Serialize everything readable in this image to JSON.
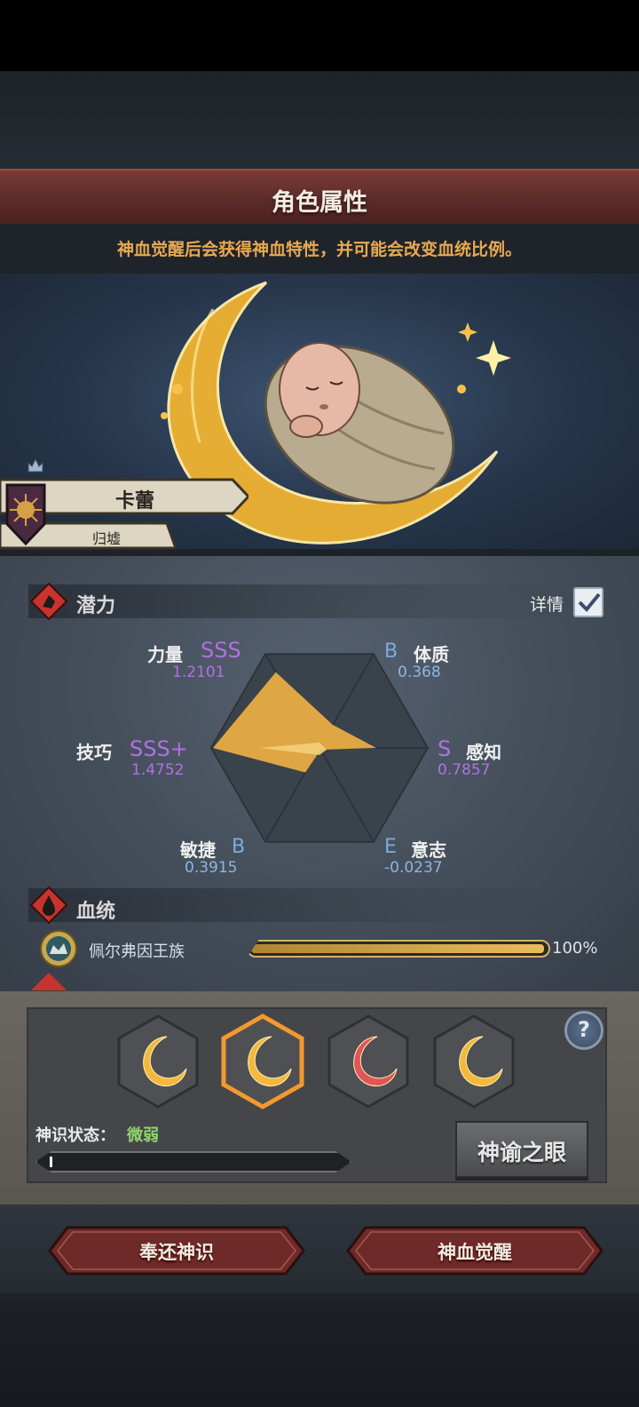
{
  "header": {
    "title": "角色属性",
    "subtitle": "神血觉醒后会获得神血特性，并可能会改变血统比例。"
  },
  "character": {
    "name": "卡蕾",
    "origin": "归墟"
  },
  "potential": {
    "section_label": "潜力",
    "detail_label": "详情",
    "detail_checked": true,
    "stats": [
      {
        "name": "力量",
        "grade": "SSS",
        "value": "1.2101",
        "raw": 1.2101
      },
      {
        "name": "体质",
        "grade": "B",
        "value": "0.368",
        "raw": 0.368
      },
      {
        "name": "感知",
        "grade": "S",
        "value": "0.7857",
        "raw": 0.7857
      },
      {
        "name": "意志",
        "grade": "E",
        "value": "-0.0237",
        "raw": -0.0237
      },
      {
        "name": "敏捷",
        "grade": "B",
        "value": "0.3915",
        "raw": 0.3915
      },
      {
        "name": "技巧",
        "grade": "SSS+",
        "value": "1.4752",
        "raw": 1.4752
      }
    ]
  },
  "bloodline": {
    "section_label": "血统",
    "name": "佩尔弗因王族",
    "percent_text": "100%",
    "percent": 100
  },
  "divine": {
    "state_label": "神识状态：",
    "state_value": "微弱",
    "progress": 0.01,
    "oracle_button": "神谕之眼",
    "help_label": "?",
    "slots": [
      {
        "color": "#f3b83c",
        "selected": false
      },
      {
        "color": "#f3b83c",
        "selected": true
      },
      {
        "color": "#e2545a",
        "selected": false
      },
      {
        "color": "#f3b83c",
        "selected": false
      }
    ]
  },
  "footer": {
    "return_button": "奉还神识",
    "awaken_button": "神血觉醒"
  },
  "colors": {
    "accent_gold": "#e8a94f",
    "grade_purple": "#b071e4",
    "grade_blue": "#7fa9d8",
    "button_red": "#6e2a28"
  }
}
